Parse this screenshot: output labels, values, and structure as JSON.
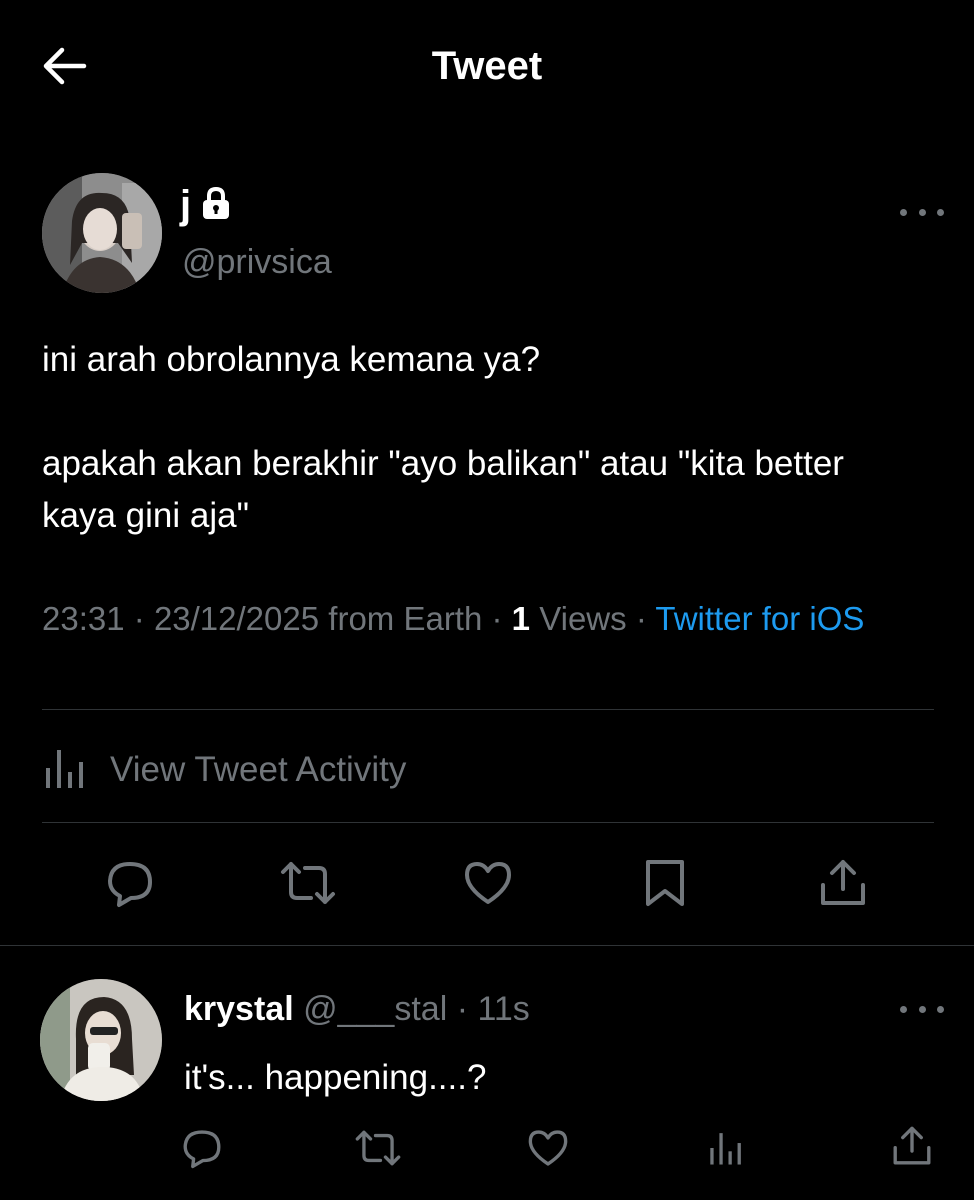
{
  "header": {
    "title": "Tweet"
  },
  "tweet": {
    "display_name": "j",
    "handle": "@privsica",
    "text": "ini arah obrolannya kemana ya?\n\napakah akan berakhir \"ayo balikan\" atau \"kita better kaya gini aja\"",
    "time": "23:31",
    "date": "23/12/2025",
    "location": "from Earth",
    "views_count": "1",
    "views_label": "Views",
    "source": "Twitter for iOS",
    "separator": "·",
    "activity_label": "View Tweet Activity"
  },
  "reply": {
    "display_name": "krystal",
    "handle": "@___stal",
    "separator": "·",
    "age": "11s",
    "text": "it's... happening....?"
  },
  "icons": {
    "back": "arrow-left-icon",
    "lock": "lock-icon",
    "more": "more-icon",
    "activity": "bar-chart-icon",
    "reply": "reply-icon",
    "retweet": "retweet-icon",
    "like": "heart-icon",
    "bookmark": "bookmark-icon",
    "share": "share-icon"
  },
  "colors": {
    "background": "#000000",
    "text": "#ffffff",
    "muted": "#71767b",
    "link": "#1d9bf0",
    "divider": "#2f3336"
  }
}
